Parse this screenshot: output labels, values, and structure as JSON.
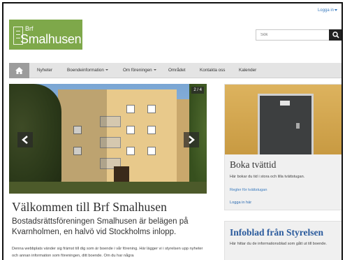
{
  "header": {
    "login_label": "Logga in",
    "logo_prefix": "Brf",
    "logo_name": "Smalhusen",
    "search_placeholder": "Sök"
  },
  "nav": {
    "items": [
      "Nyheter",
      "Boendeinformation",
      "Om föreningen",
      "Området",
      "Kontakta oss",
      "Kalender"
    ],
    "dropdown_items": [
      "Boendeinformation",
      "Om föreningen"
    ]
  },
  "slider": {
    "counter": "2 / 4"
  },
  "main": {
    "title": "Välkommen till Brf Smalhusen",
    "lead": "Bostadsrättsföreningen Smalhusen är belägen på Kvarnholmen, en halvö vid Stockholms inlopp.",
    "body": "Denna webbplats vänder sig främst till dig som är boende i vår förening. Här lägger vi i styrelsen upp nyheter och annan information som föreningen, ditt boende. Om du har några"
  },
  "sidebar": {
    "card1": {
      "title": "Boka tvättid",
      "text": "Här bokar du tid i stora och lilla tvättstugan.",
      "link1": "Regler för tvättstugan",
      "link2": "Logga in här"
    },
    "card2": {
      "title": "Infoblad från Styrelsen",
      "text": "Här hittar du de informationsblad som gått ut till boende."
    }
  },
  "colors": {
    "logo_bg": "#7ea84a",
    "nav_bg": "#e4e4e4",
    "home_bg": "#9c9c9c",
    "link": "#3a7bbf",
    "infoblad_title": "#2a5a9c"
  }
}
